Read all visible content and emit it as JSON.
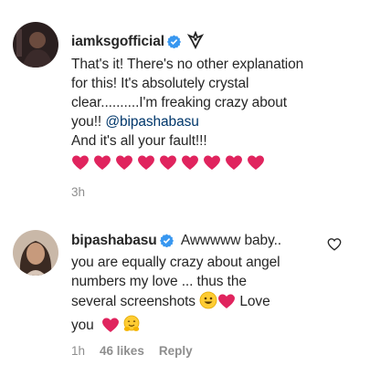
{
  "comments": [
    {
      "username": "iamksgofficial",
      "lines": [
        "That's it! There's no other explanation",
        "for this! It's absolutely crystal",
        "clear..........I'm freaking crazy about",
        "you!!"
      ],
      "mention": "@bipashabasu",
      "last_line": "And it's all your fault!!!",
      "heart_count": 9,
      "time": "3h"
    },
    {
      "username": "bipashabasu",
      "line1": "Awwwww baby..",
      "line2": "you are equally crazy about angel",
      "line3": "numbers my love ... thus the",
      "line4": "several screenshots",
      "line4_end": "Love",
      "line5": "you",
      "time": "1h",
      "likes": "46 likes",
      "reply": "Reply"
    }
  ],
  "colors": {
    "heart": "#e0245e",
    "verified": "#3897f0",
    "mention": "#00376b",
    "meta": "#8e8e8e"
  },
  "icons": [
    "verified-badge-icon",
    "emblem-icon",
    "heart-emoji-icon",
    "smile-emoji-icon",
    "hug-emoji-icon",
    "like-heart-icon"
  ]
}
